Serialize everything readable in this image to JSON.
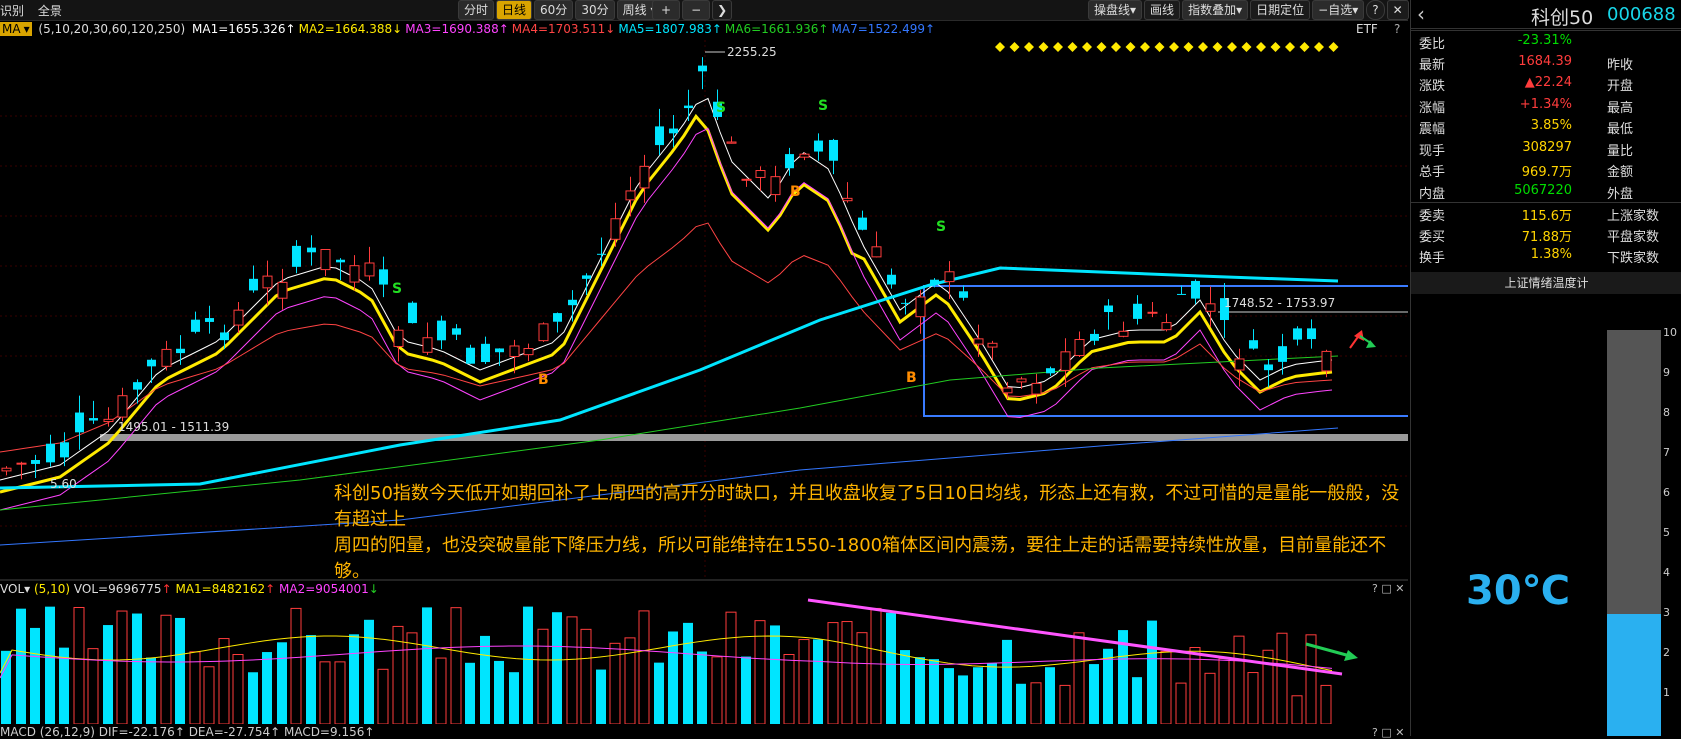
{
  "toolbar": {
    "left": [
      "识别",
      "全景"
    ],
    "periods": [
      "分时",
      "日线",
      "60分",
      "30分",
      "周线"
    ],
    "active_period": "日线",
    "zoom_plus": "+",
    "zoom_minus": "−",
    "right": [
      "操盘线",
      "画线",
      "指数叠加",
      "日期定位",
      "自选"
    ],
    "help": "?",
    "close_glyph": "✕"
  },
  "ma_indicator": {
    "name": "MA",
    "params": "(5,10,20,30,60,120,250)",
    "items": [
      {
        "text": "MA1=1655.326",
        "arrow": "↑",
        "color": "#ffffff"
      },
      {
        "text": "MA2=1664.388",
        "arrow": "↓",
        "color": "#ffea00"
      },
      {
        "text": "MA3=1690.388",
        "arrow": "↑",
        "color": "#ff44ff"
      },
      {
        "text": "MA4=1703.511",
        "arrow": "↓",
        "color": "#ff4444"
      },
      {
        "text": "MA5=1807.983",
        "arrow": "↑",
        "color": "#00e5ff"
      },
      {
        "text": "MA6=1661.936",
        "arrow": "↑",
        "color": "#22cc22"
      },
      {
        "text": "MA7=1522.499",
        "arrow": "↑",
        "color": "#3377ff"
      }
    ],
    "etf_label": "ETF",
    "help": "?"
  },
  "chart_labels": {
    "high_label": "2255.25",
    "range_label_right": "1748.52 - 1753.97",
    "range_label_left": "1495.01 - 1511.39",
    "low_label": "5.60",
    "signals": [
      "S",
      "S",
      "S",
      "S",
      "B",
      "B",
      "B"
    ]
  },
  "annotation": {
    "line1": "科创50指数今天低开如期回补了上周四的高开分时缺口，并且收盘收复了5日10日均线，形态上还有救，不过可惜的是量能一般般，没有超过上",
    "line2": "周四的阳量，也没突破量能下降压力线，所以可能维持在1550-1800箱体区间内震荡，要往上走的话需要持续性放量，目前量能还不够。"
  },
  "volume_indicator": {
    "name": "VOL",
    "params": "(5,10)",
    "vol": "VOL=9696775",
    "vol_arrow": "↑",
    "ma1": "MA1=8482162",
    "ma1_arrow": "↑",
    "ma2": "MA2=9054001",
    "ma2_arrow": "↓",
    "panel_buttons": "? □ ✕"
  },
  "macd_indicator": {
    "text": "MACD (26,12,9) DIF=-22.176↑ DEA=-27.754↑ MACD=9.156↑",
    "panel_buttons": "? □ ✕"
  },
  "right_panel": {
    "back_glyph": "‹",
    "title": "科创50",
    "code": "000688",
    "rows": [
      {
        "label": "委比",
        "value": "-23.31%",
        "color": "green",
        "label2": ""
      },
      {
        "label": "最新",
        "value": "1684.39",
        "color": "red",
        "label2": "昨收"
      },
      {
        "label": "涨跌",
        "value": "▲22.24",
        "color": "red",
        "label2": "开盘"
      },
      {
        "label": "涨幅",
        "value": "+1.34%",
        "color": "red",
        "label2": "最高"
      },
      {
        "label": "震幅",
        "value": "3.85%",
        "color": "yellow",
        "label2": "最低"
      },
      {
        "label": "现手",
        "value": "308297",
        "color": "yellow",
        "label2": "量比"
      },
      {
        "label": "总手",
        "value": "969.7万",
        "color": "yellow",
        "label2": "金额"
      },
      {
        "label": "内盘",
        "value": "5067220",
        "color": "green",
        "label2": "外盘"
      },
      {
        "label": "委卖",
        "value": "115.6万",
        "color": "yellow",
        "label2": "上涨家数"
      },
      {
        "label": "委买",
        "value": "71.88万",
        "color": "yellow",
        "label2": "平盘家数"
      },
      {
        "label": "换手",
        "value": "1.38%",
        "color": "yellow",
        "label2": "下跌家数"
      }
    ],
    "thermometer_title": "上证情绪温度计",
    "temperature": "30℃",
    "temperature_level": 0.3,
    "scale_ticks": [
      "10",
      "9",
      "8",
      "7",
      "6",
      "5",
      "4",
      "3",
      "2",
      "1"
    ]
  }
}
